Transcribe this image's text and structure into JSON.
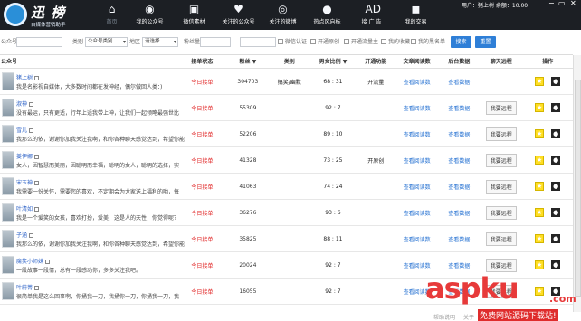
{
  "app": {
    "name": "迅 榜",
    "subtitle": "自媒体营销助手"
  },
  "nav": [
    {
      "label": "首页",
      "icon": "home-icon"
    },
    {
      "label": "我的公众号",
      "icon": "user-icon"
    },
    {
      "label": "微信素材",
      "icon": "document-icon"
    },
    {
      "label": "关注的公众号",
      "icon": "heart-icon"
    },
    {
      "label": "关注的微博",
      "icon": "weibo-icon"
    },
    {
      "label": "热点风向标",
      "icon": "hot-icon"
    },
    {
      "label": "接 广 告",
      "icon": "ad-icon"
    },
    {
      "label": "我的交易",
      "icon": "trade-icon"
    }
  ],
  "userinfo": {
    "text": "用户：猪上树  余额：10.00",
    "buttons": [
      "−",
      "▭",
      "✕"
    ]
  },
  "filter": {
    "label_account": "公众号",
    "label_category": "类别",
    "select_category": "公众号类别",
    "label_region": "地区",
    "select_region": "请选择",
    "label_fans": "粉丝量",
    "dash": "-",
    "cb1": "微信认证",
    "cb2": "开通原创",
    "cb3": "开通流量主",
    "cb4": "我的收藏",
    "cb5": "我的黑名单",
    "search_button": "搜索",
    "reset_button": "重置"
  },
  "table": {
    "columns": [
      "公众号",
      "接单状态",
      "粉丝 ▼",
      "类别",
      "男女比例 ▼",
      "开通功能",
      "文章阅读数",
      "后台数据",
      "聊天远程",
      "操作"
    ],
    "rows": [
      {
        "name": "猪上树",
        "desc": "我是名影视自媒体，大多数时间都在发神经，偶尔做回人类：)",
        "status": "今日接单",
        "fans": "304703",
        "category": "搞笑/幽默",
        "ratio": "68 : 31",
        "feature": "开流量",
        "read": "查看阅读数",
        "data": "查看数据",
        "chat": ""
      },
      {
        "name": "淑神",
        "desc": "没有最运，只有更适，行年上适我带上神，让我们一起领略最强世比",
        "status": "今日接单",
        "fans": "55309",
        "category": "",
        "ratio": "92 : 7",
        "feature": "",
        "read": "查看阅读数",
        "data": "查看数据",
        "chat": "我要远程"
      },
      {
        "name": "雪儿",
        "desc": "我那么的依，谢谢你加我关注我啊，和你各种聊天感觉达到，希望你能",
        "status": "今日接单",
        "fans": "52206",
        "category": "",
        "ratio": "89 : 10",
        "feature": "",
        "read": "查看阅读数",
        "data": "查看数据",
        "chat": "我要远程"
      },
      {
        "name": "姜伊娜",
        "desc": "女人，因智慧而美丽，因聪明而幸福，聪明的女人，聪明的选择，实",
        "status": "今日接单",
        "fans": "41328",
        "category": "",
        "ratio": "73 : 25",
        "feature": "开原创",
        "read": "查看阅读数",
        "data": "查看数据",
        "chat": "我要远程"
      },
      {
        "name": "宋玉神",
        "desc": "我需要一份关怀，需要您的喜欢，不定期会为大家送上福利的哟，每",
        "status": "今日接单",
        "fans": "41063",
        "category": "",
        "ratio": "74 : 24",
        "feature": "",
        "read": "查看阅读数",
        "data": "查看数据",
        "chat": "我要远程"
      },
      {
        "name": "叶清如",
        "desc": "我是一个爱笑的女孩，喜欢打扮，爱美，这是人的天性，你觉得呢？",
        "status": "今日接单",
        "fans": "36276",
        "category": "",
        "ratio": "93 : 6",
        "feature": "",
        "read": "查看阅读数",
        "data": "查看数据",
        "chat": "我要远程"
      },
      {
        "name": "子涵",
        "desc": "我那么的依，谢谢你加我关注我啊，和你各种聊天感觉达到，希望你能",
        "status": "今日接单",
        "fans": "35825",
        "category": "",
        "ratio": "88 : 11",
        "feature": "",
        "read": "查看阅读数",
        "data": "查看数据",
        "chat": "我要远程"
      },
      {
        "name": "魔笑小师妹",
        "desc": "一段故事一段情，总有一段感动你，多多关注我吧。",
        "status": "今日接单",
        "fans": "20024",
        "category": "",
        "ratio": "92 : 7",
        "feature": "",
        "read": "查看阅读数",
        "data": "查看数据",
        "chat": "我要远程"
      },
      {
        "name": "叶蔚菁",
        "desc": "很简单我是这么回事啊，你捅我一刀，我捅你一刀，你捅我一刀，我",
        "status": "今日接单",
        "fans": "16055",
        "category": "",
        "ratio": "92 : 7",
        "feature": "",
        "read": "查看阅读数",
        "data": "查看数据",
        "chat": "我要远程"
      }
    ]
  },
  "footer": {
    "help": "帮助说明",
    "about": "关于"
  },
  "watermark": {
    "main": "aspku",
    "com": ".com",
    "sub": "免费网站源码下载站!"
  }
}
